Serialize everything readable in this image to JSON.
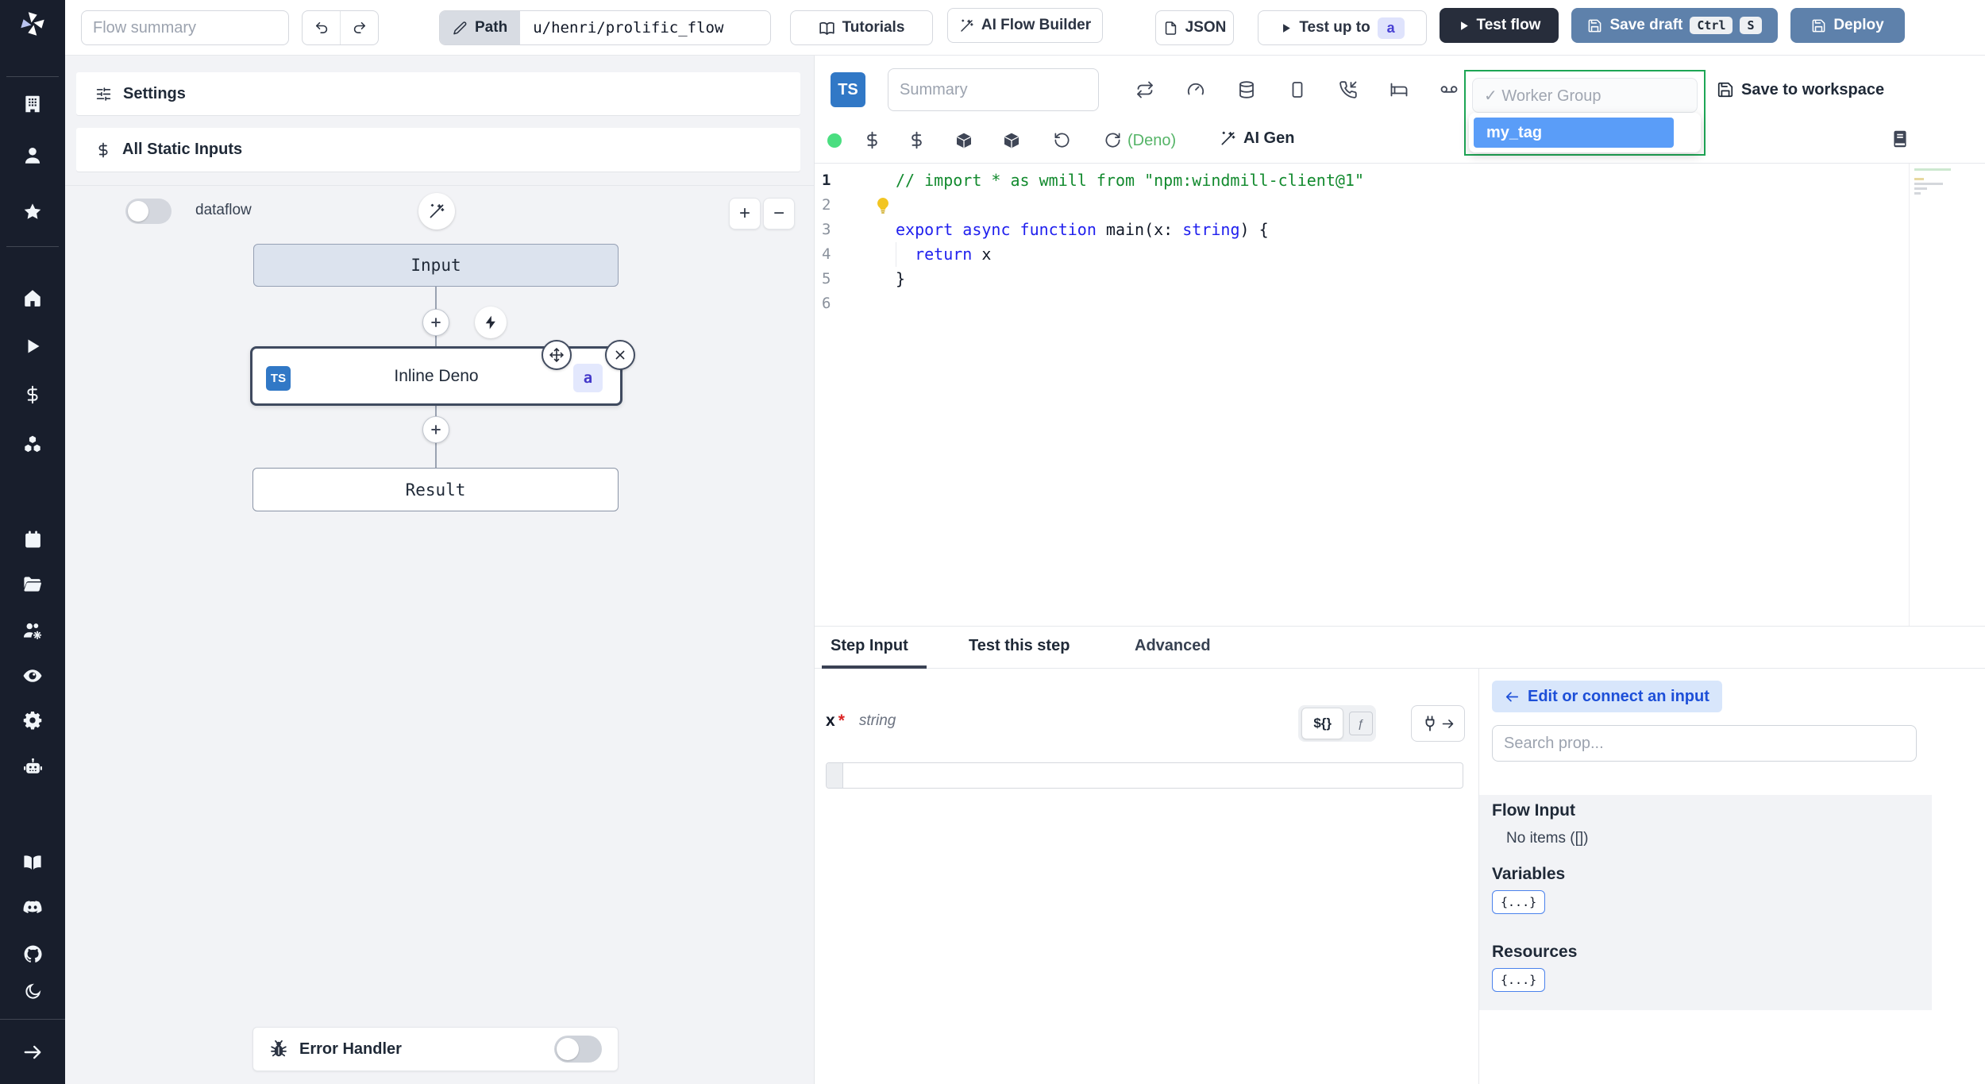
{
  "topbar": {
    "flow_summary_placeholder": "Flow summary",
    "path_label": "Path",
    "path_value": "u/henri/prolific_flow",
    "tutorials_label": "Tutorials",
    "ai_flow_builder_label": "AI Flow Builder",
    "json_label": "JSON",
    "test_up_to_label": "Test up to",
    "test_up_to_badge": "a",
    "test_flow_label": "Test flow",
    "save_draft_label": "Save draft",
    "kbd_ctrl": "Ctrl",
    "kbd_s": "S",
    "deploy_label": "Deploy"
  },
  "flow_panel": {
    "settings_label": "Settings",
    "static_inputs_label": "All Static Inputs",
    "dataflow_label": "dataflow",
    "zoom_in_label": "+",
    "zoom_out_label": "−",
    "input_node_label": "Input",
    "step_lang_badge": "TS",
    "step_node_label": "Inline Deno",
    "step_node_badge": "a",
    "result_node_label": "Result",
    "error_handler_label": "Error Handler"
  },
  "editor": {
    "lang_badge": "TS",
    "summary_placeholder": "Summary",
    "worker_group_selected": "✓ Worker Group",
    "worker_group_option": "my_tag",
    "save_to_workspace_label": "Save to workspace",
    "lang_hint": "(Deno)",
    "ai_gen_label": "AI Gen",
    "code": {
      "n1": "1",
      "n2": "2",
      "n3": "3",
      "n4": "4",
      "n5": "5",
      "n6": "6",
      "l1_comment": "// import * as wmill from \"npm:windmill-client@1\"",
      "l3_kw1": "export async function ",
      "l3_fn": "main",
      "l3_p1": "(x: ",
      "l3_kw2": "string",
      "l3_p2": ") {",
      "l4_ind": "  ",
      "l4_kw": "return",
      "l4_p": " x",
      "l5": "}"
    }
  },
  "tabs": {
    "step_input": "Step Input",
    "test_this_step": "Test this step",
    "advanced": "Advanced"
  },
  "step_form": {
    "field_name": "x",
    "required_mark": "*",
    "field_type": "string",
    "interp_toggle": "${}",
    "fn_toggle": "ƒ"
  },
  "connect_panel": {
    "edit_connect_label": "Edit or connect an input",
    "search_placeholder": "Search prop...",
    "flow_input_title": "Flow Input",
    "flow_input_empty": "No items ([])",
    "variables_title": "Variables",
    "variables_chip": "{...}",
    "resources_title": "Resources",
    "resources_chip": "{...}"
  },
  "colors": {
    "sidebar_bg": "#181e2c",
    "accent_green": "#1ea655",
    "selection_blue": "#5a9df8",
    "deploy_blue": "#5e81ab",
    "ts_blue": "#3178c6",
    "badge_indigo": "#4338ca",
    "status_green": "#4ade80"
  }
}
